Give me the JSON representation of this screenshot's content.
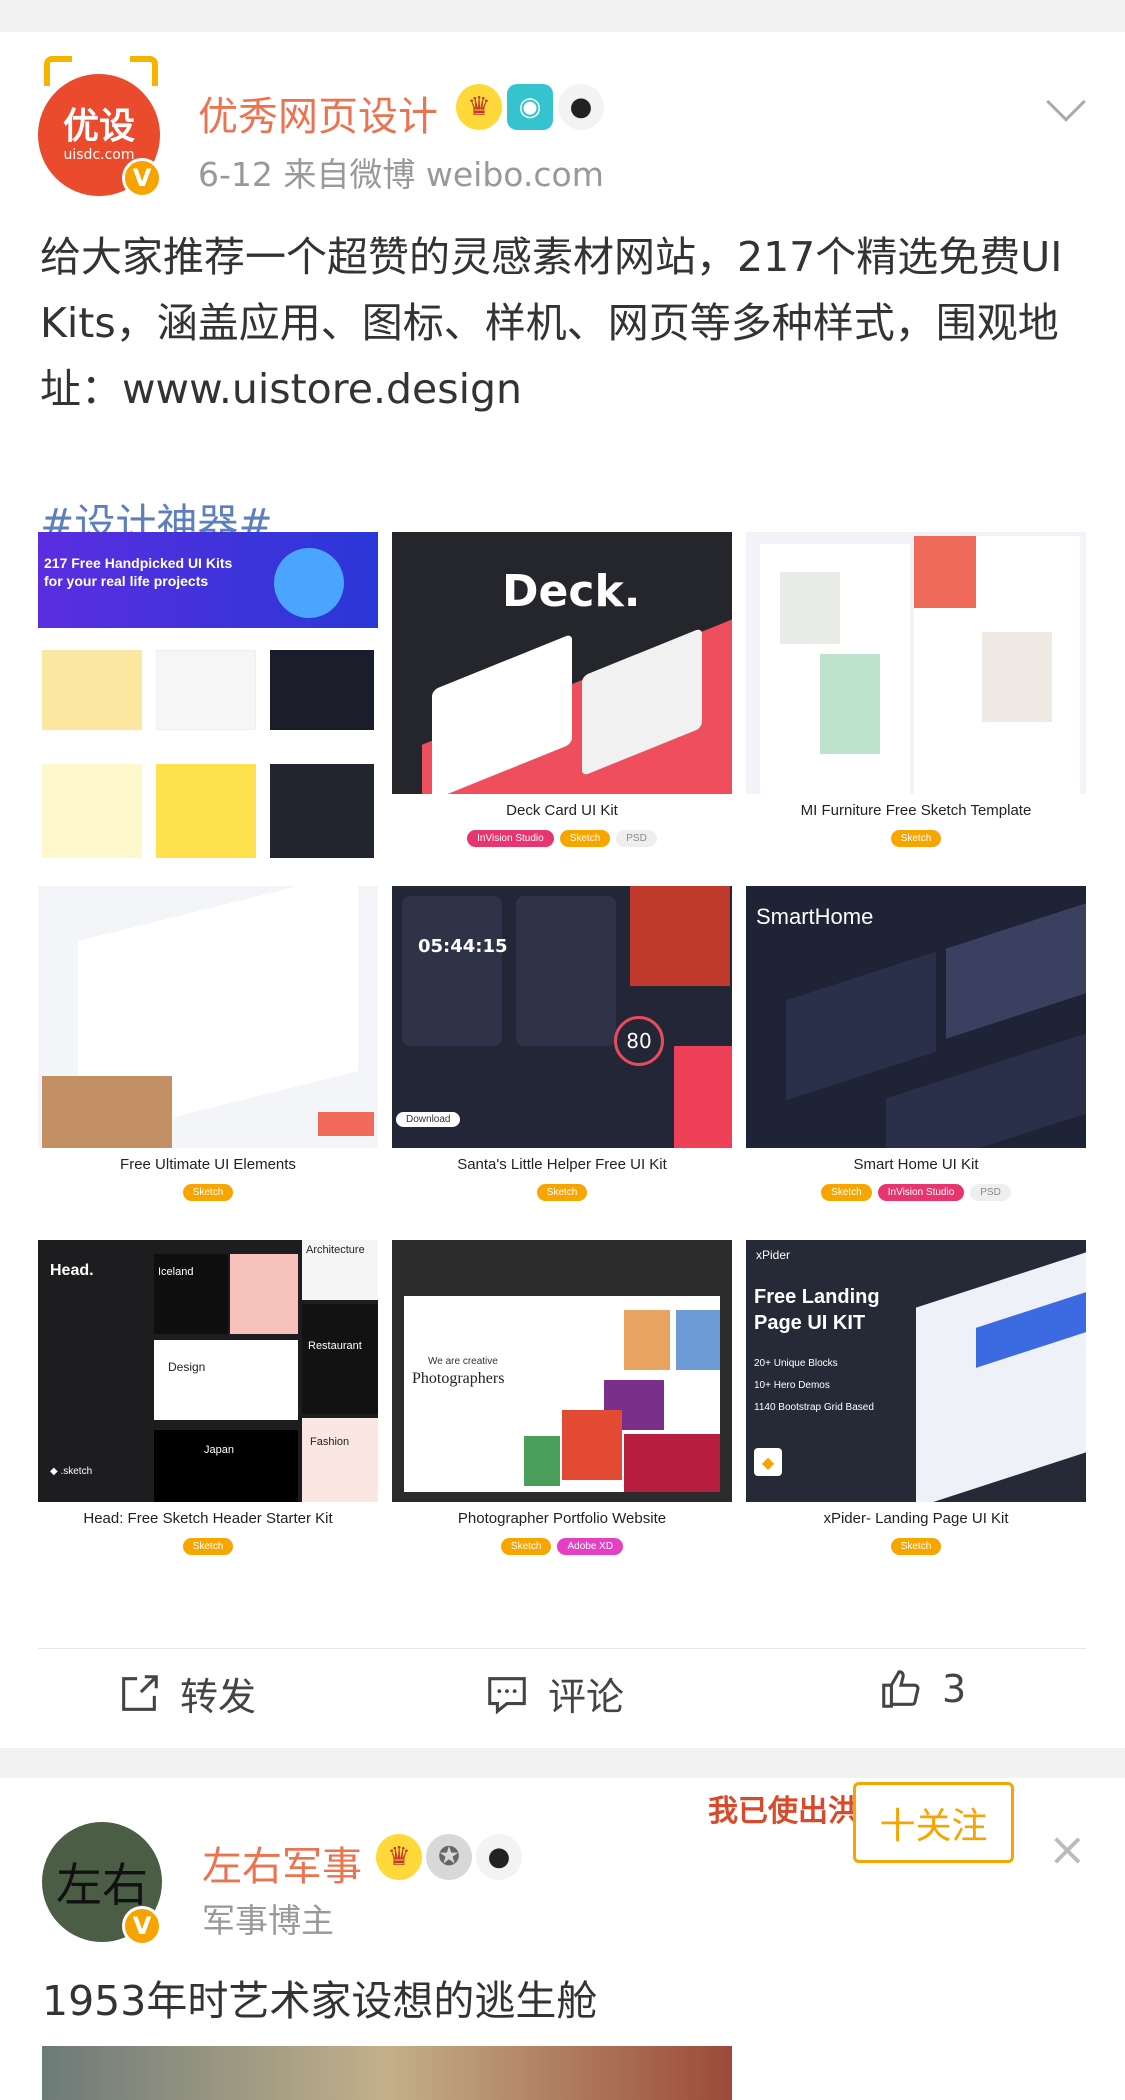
{
  "post1": {
    "username": "优秀网页设计",
    "avatar_text": "优设",
    "avatar_sub": "uisdc.com",
    "meta": "6-12  来自微博 weibo.com",
    "text": "给大家推荐一个超赞的灵感素材网站，217个精选免费UI Kits，涵盖应用、图标、样机、网页等多种样式，围观地址：www.uistore.design",
    "hashtag": "#设计神器#",
    "images": [
      {
        "caption": "",
        "tags": []
      },
      {
        "caption": "Deck Card UI Kit",
        "tags": [
          {
            "label": "InVision Studio",
            "kind": "invision"
          },
          {
            "label": "Sketch",
            "kind": "sketch"
          },
          {
            "label": "PSD",
            "kind": "psd"
          }
        ]
      },
      {
        "caption": "MI Furniture Free Sketch Template",
        "tags": [
          {
            "label": "Sketch",
            "kind": "sketch"
          }
        ]
      },
      {
        "caption": "Free Ultimate UI Elements",
        "tags": [
          {
            "label": "Sketch",
            "kind": "sketch"
          }
        ]
      },
      {
        "caption": "Santa's Little Helper Free UI Kit",
        "tags": [
          {
            "label": "Sketch",
            "kind": "sketch"
          }
        ]
      },
      {
        "caption": "Smart Home UI Kit",
        "tags": [
          {
            "label": "Sketch",
            "kind": "sketch"
          },
          {
            "label": "InVision Studio",
            "kind": "invision"
          },
          {
            "label": "PSD",
            "kind": "psd"
          }
        ]
      },
      {
        "caption": "Head: Free Sketch Header Starter Kit",
        "tags": [
          {
            "label": "Sketch",
            "kind": "sketch"
          }
        ]
      },
      {
        "caption": "Photographer Portfolio Website",
        "tags": [
          {
            "label": "Sketch",
            "kind": "sketch"
          },
          {
            "label": "Adobe XD",
            "kind": "adobe"
          }
        ]
      },
      {
        "caption": "xPider- Landing Page UI Kit",
        "tags": [
          {
            "label": "Sketch",
            "kind": "sketch"
          }
        ]
      }
    ],
    "thumb_text": {
      "t1_headline": "217 Free Handpicked UI Kits for your real life projects",
      "t2_brand": "Deck.",
      "t6_brand": "SmartHome",
      "t7_brand": "Head.",
      "t7_items": [
        "Iceland",
        "Architecture",
        "Design",
        "Restaurant",
        "Japan",
        "Fashion"
      ],
      "t7_logo": "sketch",
      "t8_title": "We are creative",
      "t8_subtitle": "Photographers",
      "t9_brand": "xPider",
      "t9_title": "Free Landing Page UI KIT",
      "t9_bullets": [
        "20+ Unique Blocks",
        "10+ Hero Demos",
        "1140 Bootstrap Grid Based"
      ],
      "t5_time": "05:44:15",
      "t5_number": "80",
      "t5_download": "Download"
    },
    "actions": {
      "repost": "转发",
      "comment": "评论",
      "like_count": "3"
    }
  },
  "post2": {
    "username": "左右军事",
    "avatar_text": "左右",
    "meta": "军事博主",
    "follow": "十关注",
    "banner": "我已使出洪荒之力！",
    "text": "1953年时艺术家设想的逃生舱"
  },
  "colors": {
    "username": "#eb7350",
    "hashtag": "#5d7fbe",
    "follow": "#f7a400",
    "verified": "#f7a400"
  }
}
